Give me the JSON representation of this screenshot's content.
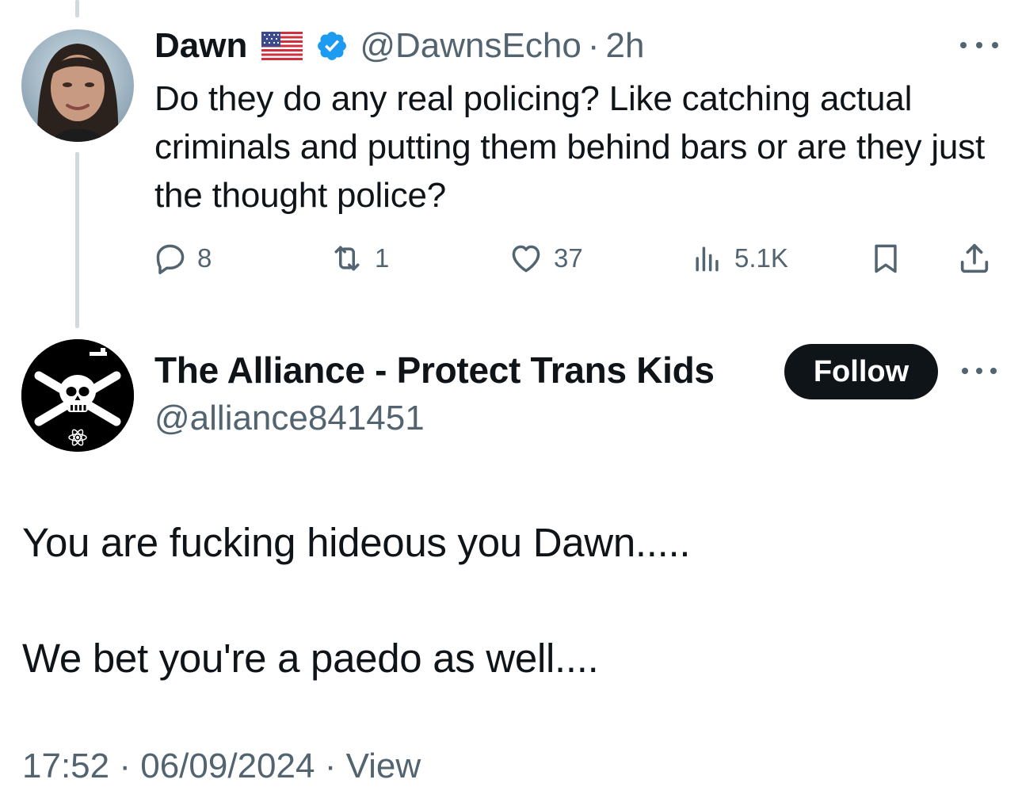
{
  "parent_tweet": {
    "author_name": "Dawn",
    "flag_icon": "us-flag-icon",
    "verified_icon": "verified-badge-icon",
    "handle": "@DawnsEcho",
    "separator": "·",
    "time": "2h",
    "text": "Do they do any real policing? Like catching actual criminals and putting them behind bars or are they just the thought police?",
    "replies": "8",
    "retweets": "1",
    "likes": "37",
    "views": "5.1K"
  },
  "reply_tweet": {
    "author_name": "The Alliance - Protect Trans Kids",
    "handle": "@alliance841451",
    "follow_label": "Follow",
    "body": [
      "You are fucking hideous you Dawn.....",
      "We bet you're a paedo as well...."
    ],
    "time": "17:52",
    "separator": "·",
    "date": "06/09/2024",
    "view_label": "View"
  },
  "colors": {
    "text_primary": "#0f1419",
    "text_secondary": "#536471",
    "verified_blue": "#1d9bf0",
    "thread_line": "#cfd9de",
    "button_bg": "#0f1419"
  }
}
